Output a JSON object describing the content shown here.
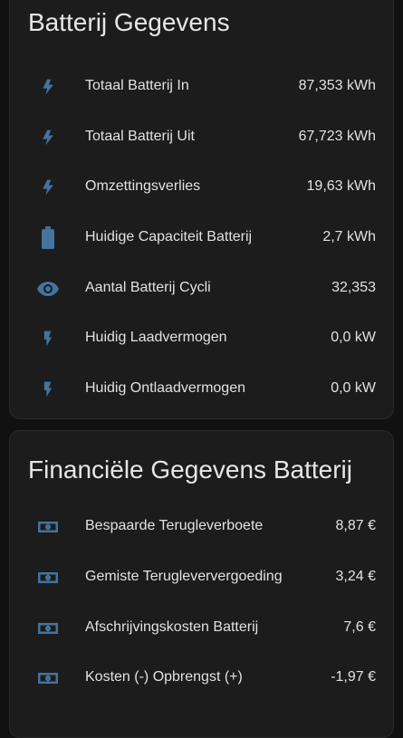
{
  "colors": {
    "background": "#111111",
    "card": "#1c1c1c",
    "icon": "#44739e",
    "text": "#e1e1e1"
  },
  "battery_card": {
    "title": "Batterij Gegevens",
    "rows": [
      {
        "icon": "flash-icon",
        "label": "Totaal Batterij In",
        "value": "87,353 kWh"
      },
      {
        "icon": "flash-icon",
        "label": "Totaal Batterij Uit",
        "value": "67,723 kWh"
      },
      {
        "icon": "flash-icon",
        "label": "Omzettingsverlies",
        "value": "19,63 kWh"
      },
      {
        "icon": "battery-icon",
        "label": "Huidige Capaciteit Batterij",
        "value": "2,7 kWh"
      },
      {
        "icon": "eye-icon",
        "label": "Aantal Batterij Cycli",
        "value": "32,353"
      },
      {
        "icon": "flash-icon",
        "label": "Huidig Laadvermogen",
        "value": "0,0 kW"
      },
      {
        "icon": "flash-icon",
        "label": "Huidig Ontlaadvermogen",
        "value": "0,0 kW"
      }
    ]
  },
  "finance_card": {
    "title": "Financiële Gegevens Batterij",
    "rows": [
      {
        "icon": "cash-icon",
        "label": "Bespaarde Terugleverboete",
        "value": "8,87 €"
      },
      {
        "icon": "cash-icon",
        "label": "Gemiste Terugleververgoeding",
        "value": "3,24 €"
      },
      {
        "icon": "cash-icon",
        "label": "Afschrijvingskosten Batterij",
        "value": "7,6 €"
      },
      {
        "icon": "cash-icon",
        "label": "Kosten (-) Opbrengst (+)",
        "value": "-1,97 €"
      }
    ]
  }
}
